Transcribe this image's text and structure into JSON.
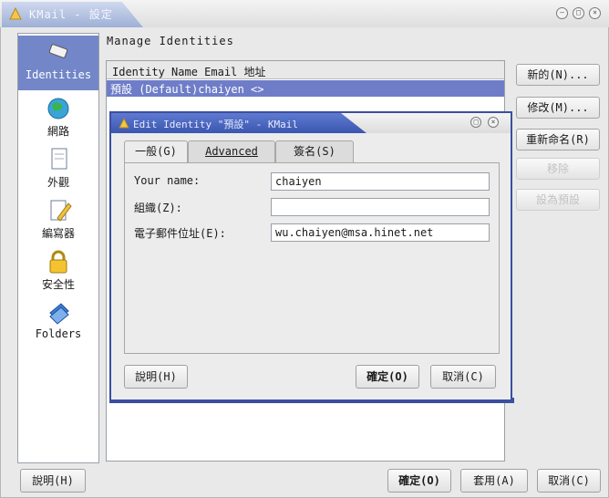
{
  "window": {
    "title": "KMail - 設定",
    "buttons": [
      "minimize",
      "maximize",
      "close"
    ]
  },
  "sidebar": {
    "items": [
      {
        "label": "Identities",
        "icon": "identities-icon",
        "active": true
      },
      {
        "label": "網路",
        "icon": "globe-icon"
      },
      {
        "label": "外觀",
        "icon": "appearance-icon"
      },
      {
        "label": "編寫器",
        "icon": "composer-icon"
      },
      {
        "label": "安全性",
        "icon": "lock-icon"
      },
      {
        "label": "Folders",
        "icon": "folders-icon"
      }
    ]
  },
  "main": {
    "heading": "Manage Identities",
    "list_header": "Identity Name Email 地址",
    "list_row": "預設 (Default)chaiyen <>"
  },
  "side_buttons": {
    "new": "新的(N)...",
    "modify": "修改(M)...",
    "rename": "重新命名(R)",
    "remove": "移除",
    "set_default": "設為預設"
  },
  "bottom": {
    "help": "說明(H)",
    "ok": "確定(O)",
    "apply": "套用(A)",
    "cancel": "取消(C)"
  },
  "dialog": {
    "title": "Edit Identity \"預設\" - KMail",
    "tabs": [
      "一般(G)",
      "Advanced",
      "簽名(S)"
    ],
    "fields": {
      "name_label": "Your name:",
      "name_value": "chaiyen",
      "org_label": "組織(Z):",
      "org_value": "",
      "email_label": "電子郵件位址(E):",
      "email_value": "wu.chaiyen@msa.hinet.net"
    },
    "help": "說明(H)",
    "ok": "確定(O)",
    "cancel": "取消(C)"
  }
}
